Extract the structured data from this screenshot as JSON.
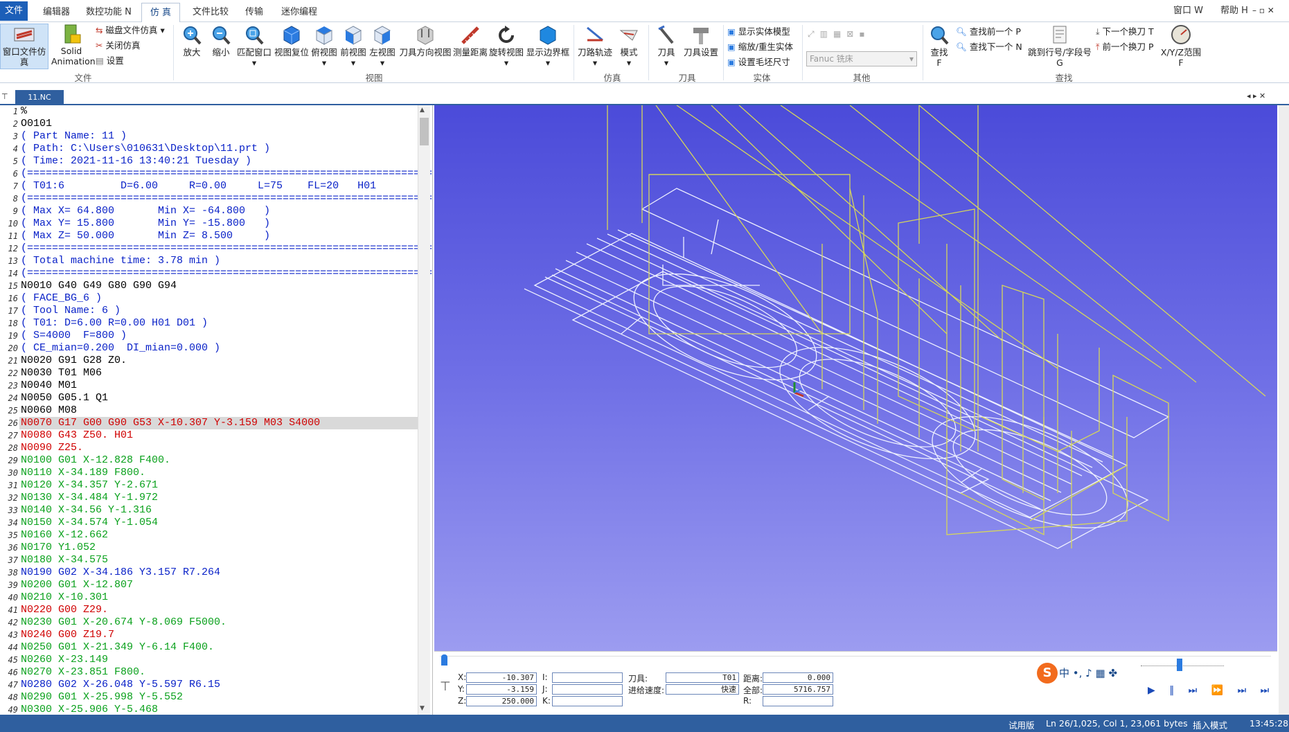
{
  "menubar": {
    "tabs": [
      "文件 F",
      "编辑器",
      "数控功能 N",
      "仿 真",
      "文件比较",
      "传输",
      "迷你编程"
    ],
    "right": [
      "窗口 W",
      "帮助 H"
    ]
  },
  "ribbon": {
    "file_group": {
      "window_sim": "窗口文件仿真",
      "solid": "Solid",
      "animation": "Animation",
      "disk_sim": "磁盘文件仿真",
      "close_sim": "关闭仿真",
      "settings": "设置",
      "label": "文件"
    },
    "view_group": {
      "zoom_in": "放大",
      "zoom_out": "缩小",
      "fit": "匹配窗口",
      "reset": "视图复位",
      "top": "俯视图",
      "front": "前视图",
      "left": "左视图",
      "tool_dir": "刀具方向视图",
      "measure": "测量距离",
      "rotate": "旋转视图",
      "bounds": "显示边界框",
      "label": "视图"
    },
    "sim_group": {
      "toolpath": "刀路轨迹",
      "mode": "模式",
      "label": "仿真"
    },
    "tool_group": {
      "tool": "刀具",
      "tool_settings": "刀具设置",
      "label": "刀具"
    },
    "solid_group": {
      "show_solid": "显示实体模型",
      "zoom_regen": "缩放/重生实体",
      "set_stock": "设置毛坯尺寸",
      "label": "实体"
    },
    "other_group": {
      "machine": "Fanuc 铣床",
      "label": "其他"
    },
    "find_group": {
      "find": "查找",
      "find_key": "F",
      "find_prev": "查找前一个 P",
      "find_next": "查找下一个 N",
      "jump": "跳到行号/字段号",
      "jump_key": "G",
      "next_tool": "下一个换刀 T",
      "prev_tool": "前一个换刀 P",
      "xyz_range": "X/Y/Z范围",
      "xyz_key": "F",
      "label": "查找"
    }
  },
  "doc_tab": "11.NC",
  "editor": {
    "highlight_line": 26,
    "lines": [
      {
        "n": "1",
        "t": "%",
        "c": "black"
      },
      {
        "n": "2",
        "t": "O0101",
        "c": "black"
      },
      {
        "n": "3",
        "t": "( Part Name: 11 )",
        "c": "blue"
      },
      {
        "n": "4",
        "t": "( Path: C:\\Users\\010631\\Desktop\\11.prt )",
        "c": "blue"
      },
      {
        "n": "5",
        "t": "( Time: 2021-11-16 13:40:21 Tuesday )",
        "c": "blue"
      },
      {
        "n": "6",
        "t": "(=================================================================",
        "c": "blue"
      },
      {
        "n": "7",
        "t": "( T01:6         D=6.00     R=0.00     L=75    FL=20   H01",
        "c": "blue"
      },
      {
        "n": "8",
        "t": "(=================================================================",
        "c": "blue"
      },
      {
        "n": "9",
        "t": "( Max X= 64.800       Min X= -64.800   )",
        "c": "blue"
      },
      {
        "n": "10",
        "t": "( Max Y= 15.800       Min Y= -15.800   )",
        "c": "blue"
      },
      {
        "n": "11",
        "t": "( Max Z= 50.000       Min Z= 8.500     )",
        "c": "blue"
      },
      {
        "n": "12",
        "t": "(=================================================================",
        "c": "blue"
      },
      {
        "n": "13",
        "t": "( Total machine time: 3.78 min )",
        "c": "blue"
      },
      {
        "n": "14",
        "t": "(=================================================================",
        "c": "blue"
      },
      {
        "n": "15",
        "t": "N0010 G40 G49 G80 G90 G94",
        "c": "black"
      },
      {
        "n": "16",
        "t": "( FACE_BG_6 )",
        "c": "blue"
      },
      {
        "n": "17",
        "t": "( Tool Name: 6 )",
        "c": "blue"
      },
      {
        "n": "18",
        "t": "( T01: D=6.00 R=0.00 H01 D01 )",
        "c": "blue"
      },
      {
        "n": "19",
        "t": "( S=4000  F=800 )",
        "c": "blue"
      },
      {
        "n": "20",
        "t": "( CE_mian=0.200  DI_mian=0.000 )",
        "c": "blue"
      },
      {
        "n": "21",
        "t": "N0020 G91 G28 Z0.",
        "c": "black"
      },
      {
        "n": "22",
        "t": "N0030 T01 M06",
        "c": "black"
      },
      {
        "n": "23",
        "t": "N0040 M01",
        "c": "black"
      },
      {
        "n": "24",
        "t": "N0050 G05.1 Q1",
        "c": "black"
      },
      {
        "n": "25",
        "t": "N0060 M08",
        "c": "black"
      },
      {
        "n": "26",
        "t": "N0070 G17 G00 G90 G53 X-10.307 Y-3.159 M03 S4000",
        "c": "red"
      },
      {
        "n": "27",
        "t": "N0080 G43 Z50. H01",
        "c": "red"
      },
      {
        "n": "28",
        "t": "N0090 Z25.",
        "c": "red"
      },
      {
        "n": "29",
        "t": "N0100 G01 X-12.828 F400.",
        "c": "green"
      },
      {
        "n": "30",
        "t": "N0110 X-34.189 F800.",
        "c": "green"
      },
      {
        "n": "31",
        "t": "N0120 X-34.357 Y-2.671",
        "c": "green"
      },
      {
        "n": "32",
        "t": "N0130 X-34.484 Y-1.972",
        "c": "green"
      },
      {
        "n": "33",
        "t": "N0140 X-34.56 Y-1.316",
        "c": "green"
      },
      {
        "n": "34",
        "t": "N0150 X-34.574 Y-1.054",
        "c": "green"
      },
      {
        "n": "35",
        "t": "N0160 X-12.662",
        "c": "green"
      },
      {
        "n": "36",
        "t": "N0170 Y1.052",
        "c": "green"
      },
      {
        "n": "37",
        "t": "N0180 X-34.575",
        "c": "green"
      },
      {
        "n": "38",
        "t": "N0190 G02 X-34.186 Y3.157 R7.264",
        "c": "blue"
      },
      {
        "n": "39",
        "t": "N0200 G01 X-12.807",
        "c": "green"
      },
      {
        "n": "40",
        "t": "N0210 X-10.301",
        "c": "green"
      },
      {
        "n": "41",
        "t": "N0220 G00 Z29.",
        "c": "red"
      },
      {
        "n": "42",
        "t": "N0230 G01 X-20.674 Y-8.069 F5000.",
        "c": "green"
      },
      {
        "n": "43",
        "t": "N0240 G00 Z19.7",
        "c": "red"
      },
      {
        "n": "44",
        "t": "N0250 G01 X-21.349 Y-6.14 F400.",
        "c": "green"
      },
      {
        "n": "45",
        "t": "N0260 X-23.149",
        "c": "green"
      },
      {
        "n": "46",
        "t": "N0270 X-23.851 F800.",
        "c": "green"
      },
      {
        "n": "47",
        "t": "N0280 G02 X-26.048 Y-5.597 R6.15",
        "c": "blue"
      },
      {
        "n": "48",
        "t": "N0290 G01 X-25.998 Y-5.552",
        "c": "green"
      },
      {
        "n": "49",
        "t": "N0300 X-25.906 Y-5.468",
        "c": "green"
      }
    ]
  },
  "sim_panel": {
    "x_label": "X:",
    "x_value": "-10.307",
    "y_label": "Y:",
    "y_value": "-3.159",
    "z_label": "Z:",
    "z_value": "250.000",
    "i_label": "I:",
    "j_label": "J:",
    "k_label": "K:",
    "tool_label": "刀具:",
    "tool_value": "T01",
    "feed_label": "进给速度:",
    "feed_value": "快速",
    "dist_label": "距离:",
    "dist_value": "0.000",
    "total_label": "全部:",
    "total_value": "5716.757",
    "r_label": "R:"
  },
  "statusbar": {
    "trial": "试用版",
    "position": "Ln 26/1,025, Col 1, 23,061 bytes",
    "mode": "插入模式",
    "time": "13:45:28"
  },
  "ime": {
    "label": "中"
  },
  "colors": {
    "accent": "#2f5f9f",
    "toolpath_white": "#eef0ff",
    "toolpath_yellow": "#d6d65a"
  }
}
